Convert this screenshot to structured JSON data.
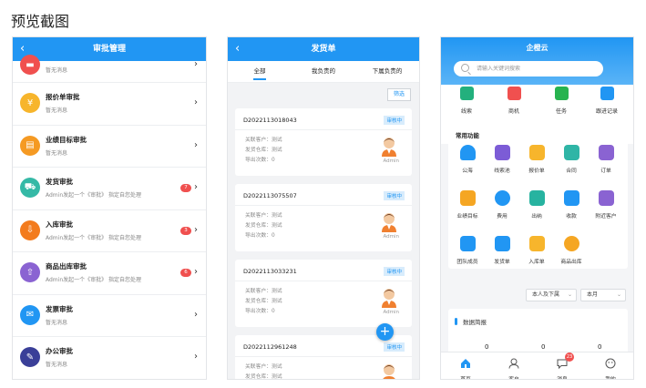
{
  "page_title": "预览截图",
  "approval": {
    "header": "审批管理",
    "items": [
      {
        "title": "",
        "sub": "暂无消息",
        "color": "#f0504f",
        "badge": ""
      },
      {
        "title": "报价单审批",
        "sub": "暂无消息",
        "color": "#f7b52c",
        "badge": ""
      },
      {
        "title": "业绩目标审批",
        "sub": "暂无消息",
        "color": "#f59a23",
        "badge": ""
      },
      {
        "title": "发货审批",
        "sub": "Admin发起一个《审批》 指定自您处理",
        "color": "#35b9a6",
        "badge": "7"
      },
      {
        "title": "入库审批",
        "sub": "Admin发起一个《审批》 指定自您处理",
        "color": "#f37b1d",
        "badge": "3"
      },
      {
        "title": "商品出库审批",
        "sub": "Admin发起一个《审批》 指定自您处理",
        "color": "#8a63d2",
        "badge": "6"
      },
      {
        "title": "发票审批",
        "sub": "暂无消息",
        "color": "#2196f3",
        "badge": ""
      },
      {
        "title": "办公审批",
        "sub": "暂无消息",
        "color": "#3a3f98",
        "badge": ""
      }
    ]
  },
  "shipping": {
    "header": "发货单",
    "tabs": [
      "全部",
      "我负责的",
      "下属负责的"
    ],
    "filter": "筛选",
    "orders": [
      {
        "no": "D2022113018043",
        "status": "审核中",
        "customer": "关联客户：测试",
        "warehouse": "发货仓库：测试",
        "exports": "导出次数：0",
        "user": "Admin"
      },
      {
        "no": "D2022113075507",
        "status": "审核中",
        "customer": "关联客户：测试",
        "warehouse": "发货仓库：测试",
        "exports": "导出次数：0",
        "user": "Admin"
      },
      {
        "no": "D2022113033231",
        "status": "审核中",
        "customer": "关联客户：测试",
        "warehouse": "发货仓库：测试",
        "exports": "导出次数：0",
        "user": "Admin"
      },
      {
        "no": "D2022112961248",
        "status": "审核中",
        "customer": "关联客户：测试",
        "warehouse": "发货仓库：测试",
        "exports": "",
        "user": ""
      }
    ],
    "fab": "+"
  },
  "home": {
    "app_title": "企橙云",
    "search_placeholder": "请输入关键词搜索",
    "quick": [
      {
        "label": "线索",
        "color": "#23b07d"
      },
      {
        "label": "商机",
        "color": "#f0504f"
      },
      {
        "label": "任务",
        "color": "#27b34f"
      },
      {
        "label": "跟进记录",
        "color": "#2196f3"
      }
    ],
    "functions_title": "常用功能",
    "functions": [
      {
        "label": "公海",
        "color": "#2196f3"
      },
      {
        "label": "线索池",
        "color": "#7c5cd6"
      },
      {
        "label": "报价单",
        "color": "#f7b52c"
      },
      {
        "label": "合同",
        "color": "#2fb5a6"
      },
      {
        "label": "订单",
        "color": "#8a63d2"
      },
      {
        "label": "业绩目标",
        "color": "#f5a623"
      },
      {
        "label": "费用",
        "color": "#2196f3"
      },
      {
        "label": "出纳",
        "color": "#27b3a0"
      },
      {
        "label": "收款",
        "color": "#2196f3"
      },
      {
        "label": "附近客户",
        "color": "#8a63d2"
      },
      {
        "label": "团队成员",
        "color": "#2196f3"
      },
      {
        "label": "发货单",
        "color": "#2196f3"
      },
      {
        "label": "入库单",
        "color": "#f7b52c"
      },
      {
        "label": "商品出库",
        "color": "#f5a623"
      }
    ],
    "scope_select": "本人及下属",
    "period_select": "本月",
    "data_title": "数据简报",
    "data_values": [
      "0",
      "0",
      "0"
    ],
    "nav": [
      {
        "label": "首页",
        "badge": ""
      },
      {
        "label": "客户",
        "badge": ""
      },
      {
        "label": "消息",
        "badge": "23"
      },
      {
        "label": "我的",
        "badge": ""
      }
    ]
  }
}
